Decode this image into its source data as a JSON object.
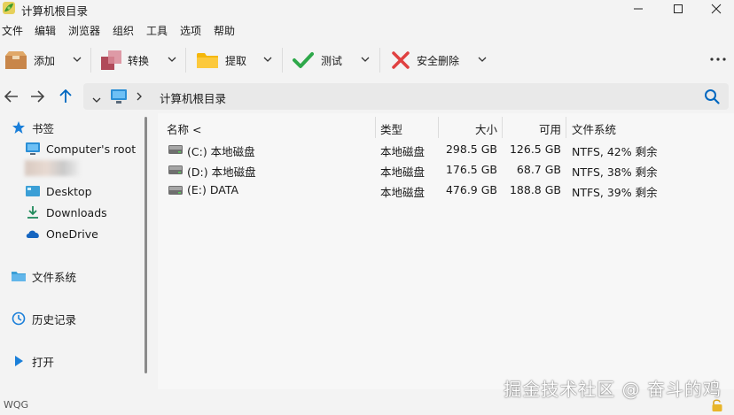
{
  "window": {
    "title": "计算机根目录"
  },
  "menubar": {
    "items": [
      "文件",
      "编辑",
      "浏览器",
      "组织",
      "工具",
      "选项",
      "帮助"
    ]
  },
  "toolbar": {
    "add_label": "添加",
    "convert_label": "转换",
    "extract_label": "提取",
    "test_label": "测试",
    "delete_label": "安全删除"
  },
  "address": {
    "path": "计算机根目录"
  },
  "sidebar": {
    "bookmarks_label": "书签",
    "items": [
      "Computer's root",
      "Desktop",
      "Downloads",
      "OneDrive"
    ],
    "filesystem_label": "文件系统",
    "history_label": "历史记录",
    "open_label": "打开"
  },
  "table": {
    "headers": {
      "name": "名称",
      "type": "类型",
      "size": "大小",
      "free": "可用",
      "fs": "文件系统"
    },
    "sort_indicator": "<",
    "rows": [
      {
        "name": "(C:) 本地磁盘",
        "type": "本地磁盘",
        "size": "298.5 GB",
        "free": "126.5 GB",
        "fs": "NTFS, 42% 剩余"
      },
      {
        "name": "(D:) 本地磁盘",
        "type": "本地磁盘",
        "size": "176.5 GB",
        "free": "68.7 GB",
        "fs": "NTFS, 38% 剩余"
      },
      {
        "name": "(E:) DATA",
        "type": "本地磁盘",
        "size": "476.9 GB",
        "free": "188.8 GB",
        "fs": "NTFS, 39% 剩余"
      }
    ]
  },
  "status": {
    "text": "WQG"
  },
  "watermark": "掘金技术社区 @ 奋斗的鸡",
  "colors": {
    "accent": "#0067c0",
    "delete_red": "#e04040",
    "test_green": "#2ea84a",
    "folder_yellow": "#f5b70a"
  }
}
